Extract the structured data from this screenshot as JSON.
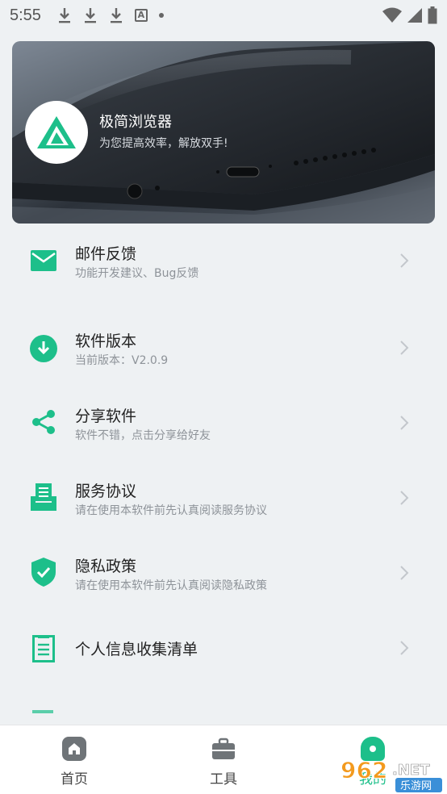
{
  "status_bar": {
    "time": "5:55",
    "icons": [
      "download-icon",
      "download-icon",
      "download-icon",
      "a-icon",
      "dot-icon",
      "wifi-icon",
      "signal-icon",
      "battery-icon"
    ]
  },
  "banner": {
    "app_name": "极简浏览器",
    "slogan": "为您提高效率，解放双手!"
  },
  "menu": {
    "items": [
      {
        "icon": "mail-icon",
        "title": "邮件反馈",
        "subtitle": "功能开发建议、Bug反馈"
      },
      {
        "icon": "download-circle-icon",
        "title": "软件版本",
        "subtitle": "当前版本：V2.0.9"
      },
      {
        "icon": "share-icon",
        "title": "分享软件",
        "subtitle": "软件不错，点击分享给好友"
      },
      {
        "icon": "agreement-icon",
        "title": "服务协议",
        "subtitle": "请在使用本软件前先认真阅读服务协议"
      },
      {
        "icon": "shield-check-icon",
        "title": "隐私政策",
        "subtitle": "请在使用本软件前先认真阅读隐私政策"
      },
      {
        "icon": "list-doc-icon",
        "title": "个人信息收集清单",
        "subtitle": ""
      }
    ]
  },
  "bottom_nav": {
    "items": [
      {
        "icon": "home-icon",
        "label": "首页"
      },
      {
        "icon": "toolbox-icon",
        "label": "工具"
      },
      {
        "icon": "profile-icon",
        "label": "我的"
      }
    ]
  },
  "watermark": {
    "number": "962",
    "suffix": ".NET",
    "site": "乐游网"
  },
  "colors": {
    "accent": "#1dbf8a",
    "background": "#eef1f3",
    "chevron": "#c3c7cc"
  }
}
